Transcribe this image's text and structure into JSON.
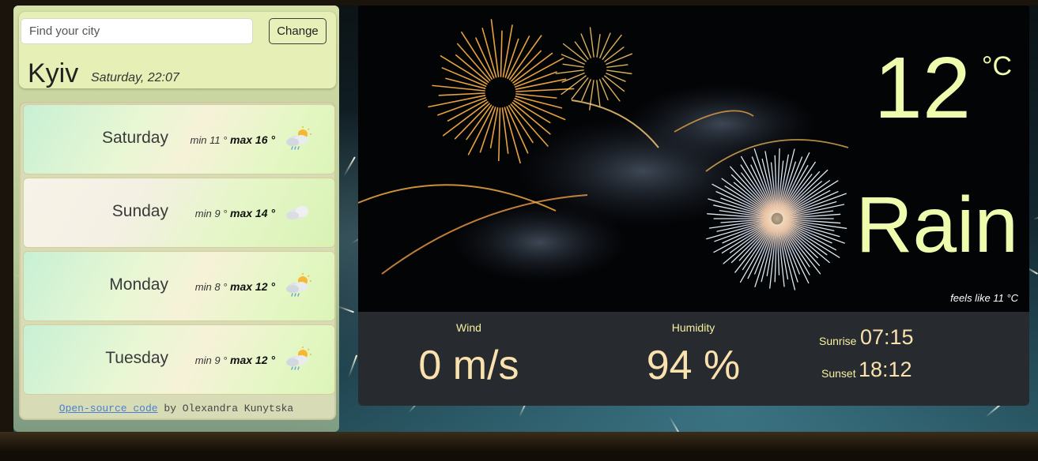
{
  "search": {
    "placeholder": "Find your city",
    "button_label": "Change"
  },
  "location": {
    "city": "Kyiv",
    "datetime": "Saturday, 22:07"
  },
  "forecast": [
    {
      "day": "Saturday",
      "min": "min 11 °",
      "max": "max 16 °",
      "icon": "rain-sun-icon"
    },
    {
      "day": "Sunday",
      "min": "min 9 °",
      "max": "max 14 °",
      "icon": "cloud-icon"
    },
    {
      "day": "Monday",
      "min": "min 8 °",
      "max": "max 12 °",
      "icon": "rain-sun-icon"
    },
    {
      "day": "Tuesday",
      "min": "min 9 °",
      "max": "max 12 °",
      "icon": "rain-sun-icon"
    }
  ],
  "credit": {
    "link_text": "Open-source code",
    "suffix": " by Olexandra Kunytska"
  },
  "current": {
    "temperature": "12",
    "unit": "°C",
    "description": "Rain",
    "feels_like": "feels like 11 °C"
  },
  "stats": {
    "wind_label": "Wind",
    "wind_value": "0 m/s",
    "humidity_label": "Humidity",
    "humidity_value": "94 %",
    "sunrise_label": "Sunrise",
    "sunrise_value": "07:15",
    "sunset_label": "Sunset",
    "sunset_value": "18:12"
  },
  "colors": {
    "accent": "#eefcae",
    "stat_value": "#fae2ae",
    "stat_label": "#f5f0a0",
    "stats_bg": "#272b30",
    "panel_bg": "#e6f0b6"
  }
}
